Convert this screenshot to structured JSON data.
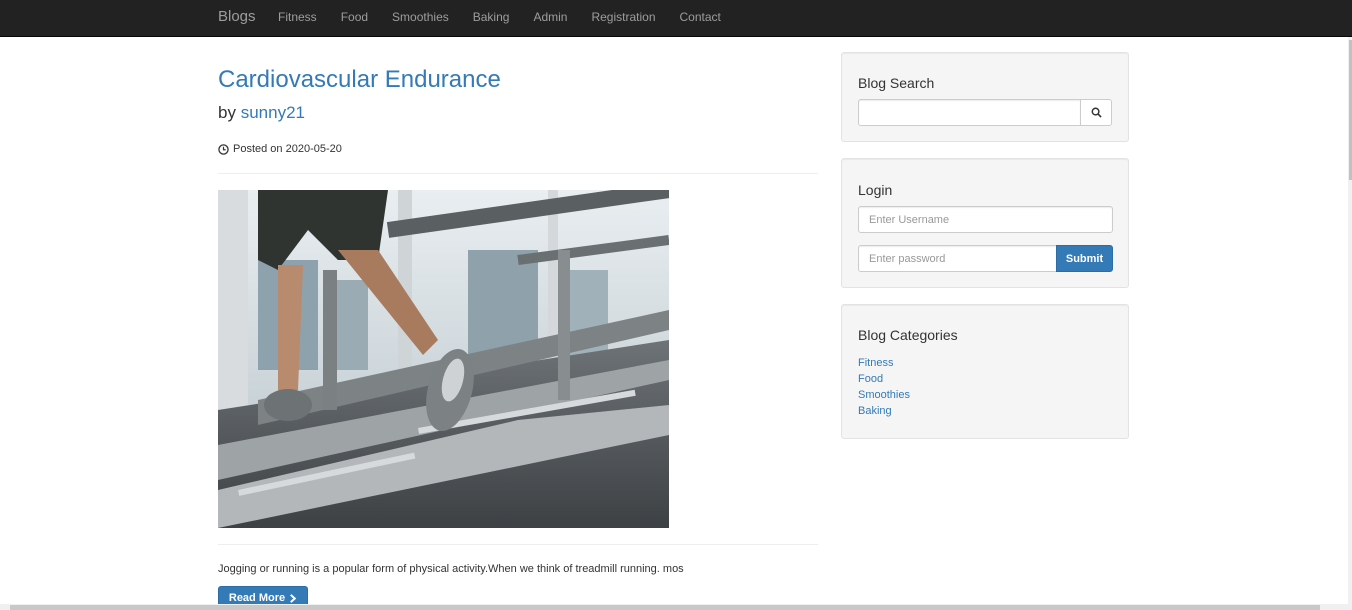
{
  "navbar": {
    "brand": "Blogs",
    "items": [
      "Fitness",
      "Food",
      "Smoothies",
      "Baking",
      "Admin",
      "Registration",
      "Contact"
    ]
  },
  "post": {
    "title": "Cardiovascular Endurance",
    "by_prefix": "by",
    "author": "sunny21",
    "posted_label": "Posted on 2020-05-20",
    "image_alt": "treadmill-running-photo",
    "excerpt": "Jogging or running is a popular form of physical activity.When we think of treadmill running. mos",
    "read_more_label": "Read More"
  },
  "sidebar": {
    "search": {
      "heading": "Blog Search",
      "placeholder": ""
    },
    "login": {
      "heading": "Login",
      "username_placeholder": "Enter Username",
      "password_placeholder": "Enter password",
      "submit_label": "Submit"
    },
    "categories": {
      "heading": "Blog Categories",
      "items": [
        "Fitness",
        "Food",
        "Smoothies",
        "Baking"
      ]
    }
  },
  "colors": {
    "navbar_bg": "#222222",
    "nav_text": "#9d9d9d",
    "link": "#337ab7",
    "primary_button": "#337ab7",
    "well_bg": "#f5f5f5"
  },
  "icons": {
    "posted": "clock-icon",
    "read_more": "chevron-right-icon",
    "search": "search-icon"
  }
}
